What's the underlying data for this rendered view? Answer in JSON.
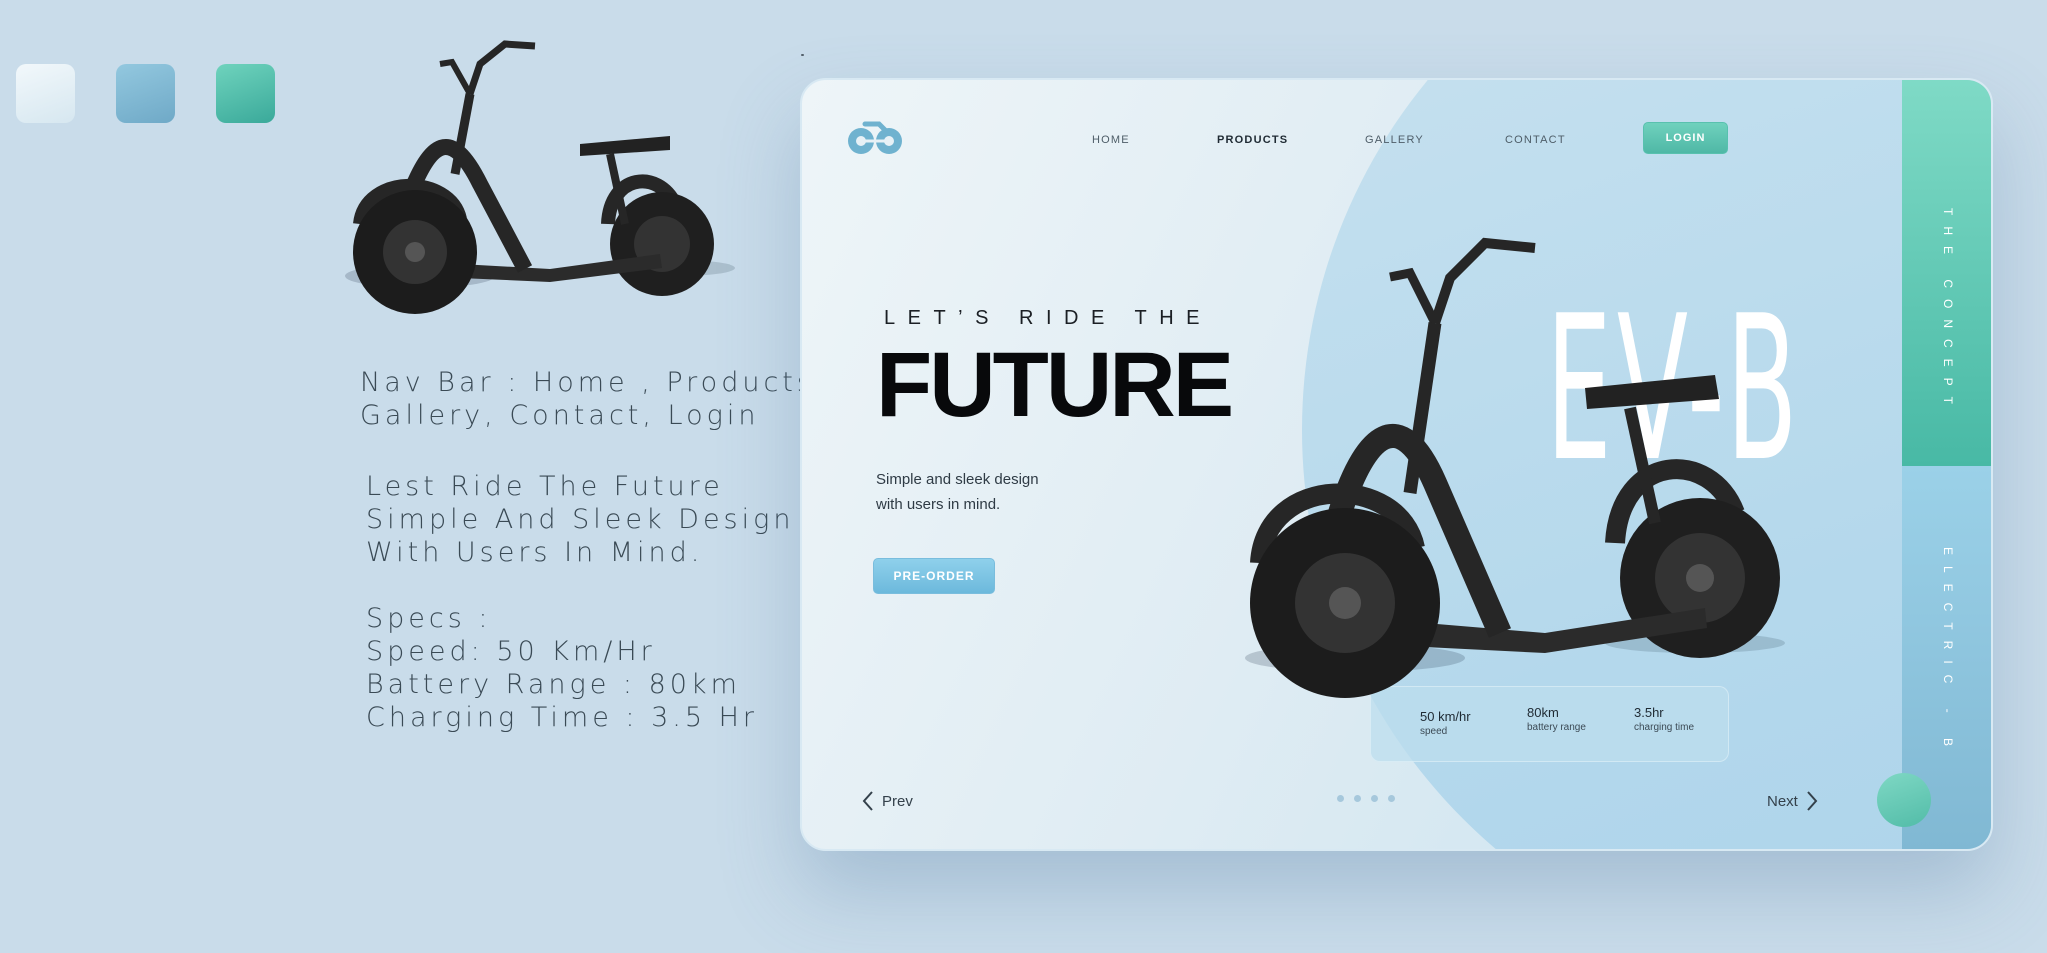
{
  "swatches": [
    "#eaf4f8",
    "#82bcd8",
    "#55c1ad"
  ],
  "notes": {
    "nav_lines": [
      "Nav Bar : Home , Products,",
      "Gallery, Contact, Login"
    ],
    "hero_lines": [
      "Lest Ride The Future",
      "Simple And Sleek Design",
      "With Users In Mind."
    ],
    "spec_lines": [
      "Specs :",
      "Speed: 50 Km/Hr",
      "Battery Range : 80km",
      "Charging Time : 3.5 Hr"
    ]
  },
  "card": {
    "logo_icon": "bike-logo-icon",
    "nav": {
      "home": "HOME",
      "products": "PRODUCTS",
      "gallery": "GALLERY",
      "contact": "CONTACT",
      "login": "LOGIN"
    },
    "hero": {
      "tagline": "LET’S RIDE THE",
      "headline": "FUTURE",
      "desc_lines": [
        "Simple and sleek design",
        "with users in mind."
      ],
      "cta": "PRE-ORDER"
    },
    "model": "EV-B",
    "specs": [
      {
        "value": "50 km/hr",
        "label": "speed"
      },
      {
        "value": "80km",
        "label": "battery range"
      },
      {
        "value": "3.5hr",
        "label": "charging time"
      }
    ],
    "pager": {
      "prev": "Prev",
      "next": "Next",
      "dots": 4
    },
    "side": {
      "top_text": "THE CONCEPT",
      "bottom_text": "ELECTRIC - B"
    }
  },
  "colors": {
    "accent_teal": "#55c1ad",
    "accent_blue": "#82bcd8",
    "background": "#c9dcea"
  }
}
